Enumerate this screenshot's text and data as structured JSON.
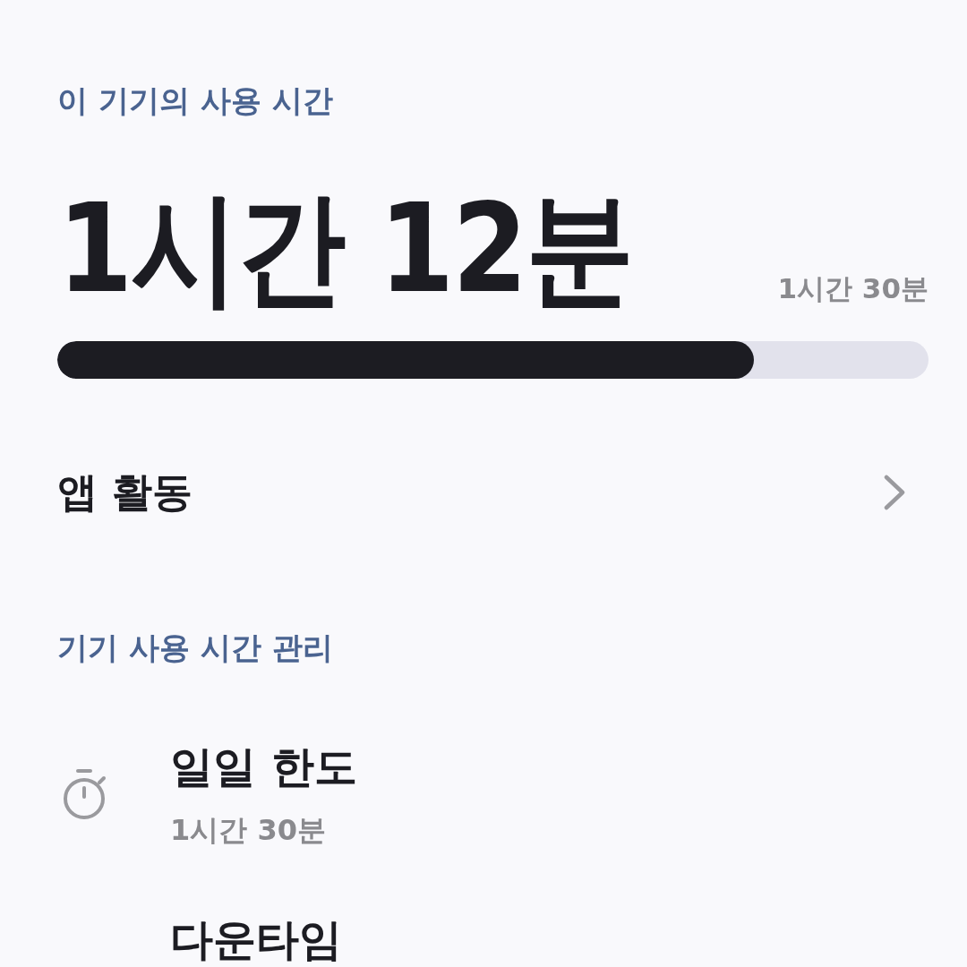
{
  "usage": {
    "label": "이 기기의 사용 시간",
    "total": "1시간 12분",
    "limit": "1시간 30분",
    "level": 0.8
  },
  "app_activity": {
    "label": "앱 활동"
  },
  "management": {
    "heading": "기기 사용 시간 관리",
    "items": [
      {
        "kind": "timer",
        "title": "일일 한도",
        "subtitle": "1시간 30분"
      },
      {
        "kind": "downtime",
        "title": "다운타임"
      }
    ]
  }
}
